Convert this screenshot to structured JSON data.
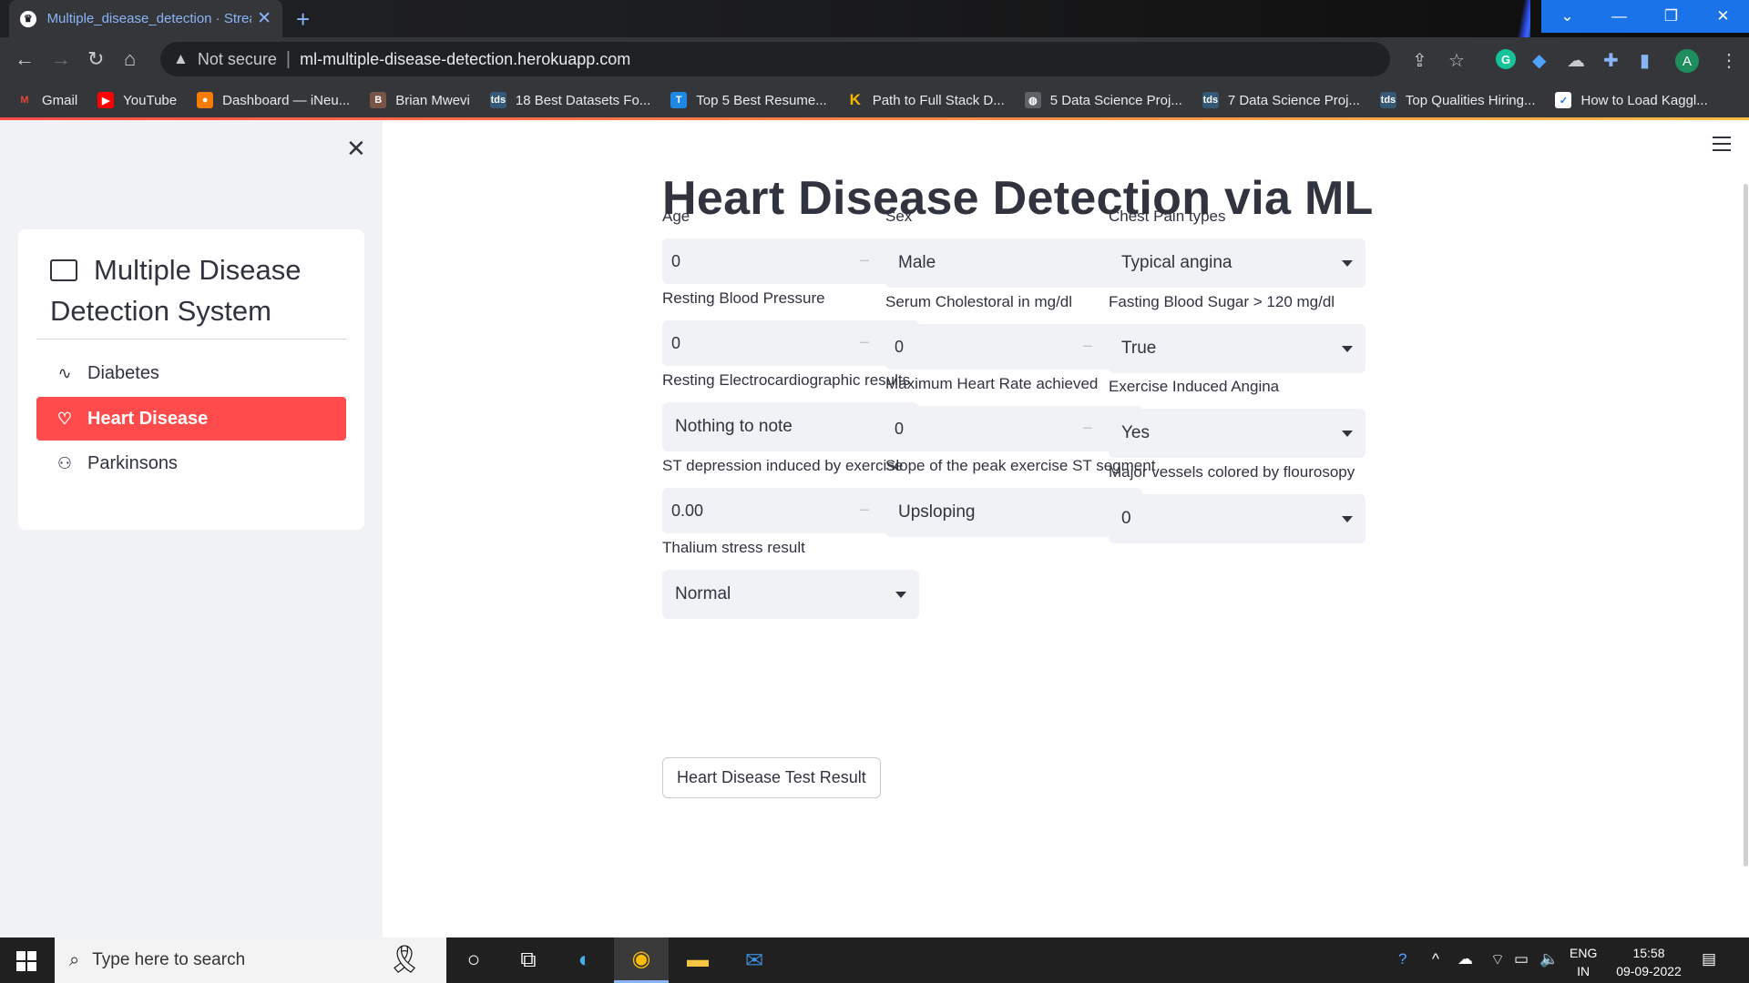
{
  "browser": {
    "tab_title": "Multiple_disease_detection · Streamlit",
    "tab_favicon": "streamlit-crown-icon",
    "new_tab": "+",
    "security_label": "Not secure",
    "url": "ml-multiple-disease-detection.herokuapp.com",
    "profile_initial": "A",
    "window_controls": [
      "⌄",
      "—",
      "❐",
      "✕"
    ],
    "bookmarks": [
      {
        "label": "Gmail",
        "icon": "gmail-icon",
        "color": "#ea4335",
        "glyph": "M"
      },
      {
        "label": "YouTube",
        "icon": "youtube-icon",
        "color": "#ff0000",
        "glyph": "▶"
      },
      {
        "label": "Dashboard — iNeu...",
        "icon": "ineuron-icon",
        "color": "#f57c00",
        "glyph": "●"
      },
      {
        "label": "Brian Mwevi",
        "icon": "avatar-icon",
        "color": "#795548",
        "glyph": "B"
      },
      {
        "label": "18 Best Datasets Fo...",
        "icon": "tds-icon",
        "color": "#355876",
        "glyph": "tds"
      },
      {
        "label": "Top 5 Best Resume...",
        "icon": "t-icon",
        "color": "#1e88e5",
        "glyph": "T"
      },
      {
        "label": "Path to Full Stack D...",
        "icon": "k-icon",
        "color": "#f9b800",
        "glyph": "K"
      },
      {
        "label": "5 Data Science Proj...",
        "icon": "globe-icon",
        "color": "#5f6368",
        "glyph": "◍"
      },
      {
        "label": "7 Data Science Proj...",
        "icon": "tds-icon",
        "color": "#355876",
        "glyph": "tds"
      },
      {
        "label": "Top Qualities Hiring...",
        "icon": "tds-icon",
        "color": "#355876",
        "glyph": "tds"
      },
      {
        "label": "How to Load Kaggl...",
        "icon": "kaggle-icon",
        "color": "#ffffff",
        "glyph": "✓"
      }
    ]
  },
  "sidebar": {
    "title": "Multiple Disease Detection System",
    "items": [
      {
        "label": "Diabetes",
        "icon": "activity-icon",
        "glyph": "∿",
        "active": false
      },
      {
        "label": "Heart Disease",
        "icon": "heart-icon",
        "glyph": "♡",
        "active": true
      },
      {
        "label": "Parkinsons",
        "icon": "person-icon",
        "glyph": "⚇",
        "active": false
      }
    ]
  },
  "main": {
    "title": "Heart Disease Detection via ML",
    "fields": [
      {
        "label": "Age",
        "kind": "number",
        "value": "0"
      },
      {
        "label": "Sex",
        "kind": "select",
        "value": "Male"
      },
      {
        "label": "Chest Pain types",
        "kind": "select",
        "value": "Typical angina"
      },
      {
        "label": "Resting Blood Pressure",
        "kind": "number",
        "value": "0"
      },
      {
        "label": "Serum Cholestoral in mg/dl",
        "kind": "number",
        "value": "0"
      },
      {
        "label": "Fasting Blood Sugar > 120 mg/dl",
        "kind": "select",
        "value": "True"
      },
      {
        "label": "Resting Electrocardiographic results",
        "kind": "select",
        "value": "Nothing to note"
      },
      {
        "label": "Maximum Heart Rate achieved",
        "kind": "number",
        "value": "0"
      },
      {
        "label": "Exercise Induced Angina",
        "kind": "select",
        "value": "Yes"
      },
      {
        "label": "ST depression induced by exercise",
        "kind": "number",
        "value": "0.00"
      },
      {
        "label": "Slope of the peak exercise ST segment",
        "kind": "select",
        "value": "Upsloping"
      },
      {
        "label": "Major vessels colored by flourosopy",
        "kind": "select",
        "value": "0"
      },
      {
        "label": "Thalium stress result",
        "kind": "select",
        "value": "Normal"
      }
    ],
    "stepper_minus": "−",
    "stepper_plus": "+",
    "submit_label": "Heart Disease Test Result"
  },
  "taskbar": {
    "search_placeholder": "Type here to search",
    "lang_line1": "ENG",
    "lang_line2": "IN",
    "time": "15:58",
    "date": "09-09-2022"
  },
  "colors": {
    "accent": "#ff4b4b",
    "sidebar_bg": "#f0f2f6",
    "input_bg": "#f0f2f6",
    "text": "#31333f"
  }
}
